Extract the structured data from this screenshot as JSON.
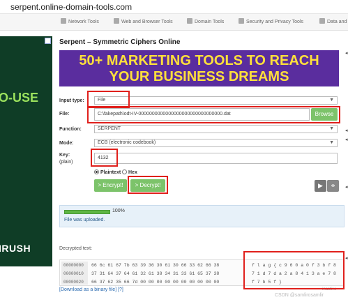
{
  "browser": {
    "url": "serpent.online-domain-tools.com"
  },
  "nav": [
    {
      "label": "Network Tools",
      "icon": "network-icon"
    },
    {
      "label": "Web and Browser Tools",
      "icon": "browser-icon"
    },
    {
      "label": "Domain Tools",
      "icon": "domain-icon"
    },
    {
      "label": "Security and Privacy Tools",
      "icon": "shield-icon"
    },
    {
      "label": "Data and",
      "icon": "data-icon"
    }
  ],
  "ad_left": {
    "headline": "O-USE",
    "brand": "IRUSH"
  },
  "page": {
    "title": "Serpent – Symmetric Ciphers Online"
  },
  "banner": {
    "line1": "50+ MARKETING TOOLS TO REACH",
    "line2": "YOUR BUSINESS DREAMS"
  },
  "form": {
    "input_type_label": "Input type:",
    "input_type_value": "File",
    "file_label": "File:",
    "file_value": "C:\\fakepath\\odt-IV-0000000000000000000000000000000.dat",
    "browse_label": "Browse",
    "function_label": "Function:",
    "function_value": "SERPENT",
    "mode_label": "Mode:",
    "mode_value": "ECB (electronic codebook)",
    "key_label": "Key:",
    "key_sublabel": "(plain)",
    "key_value": "4132",
    "radio_plaintext": "Plaintext",
    "radio_hex": "Hex",
    "encrypt_label": "> Encrypt!",
    "decrypt_label": "> Decrypt!"
  },
  "status": {
    "progress_pct": "100%",
    "progress_value": 1.0,
    "message": "File was uploaded."
  },
  "decrypted": {
    "label": "Decrypted text:",
    "rows": [
      {
        "offset": "00000000",
        "hex": "66 6c 61 67 7b 63 39 36 30 61 30 66 33 62 66 38",
        "ascii": "f l a g { c 9 6 0 a 0 f 3 b f 8"
      },
      {
        "offset": "00000010",
        "hex": "37 31 64 37 64 61 32 61 38 34 31 33 61 65 37 38",
        "ascii": "7 1 d 7 d a 2 a 8 4 1 3 a e 7 8"
      },
      {
        "offset": "00000020",
        "hex": "66 37 62 35 66 7d 00 00 00 00 00 00 00 00 00 00",
        "ascii": "f 7 b 5 f }"
      }
    ],
    "footer_link": "[Download as a binary file]",
    "footer_help": "[?]",
    "inactive": "inactive"
  },
  "watermark": "CSDN @samlirosamlir"
}
